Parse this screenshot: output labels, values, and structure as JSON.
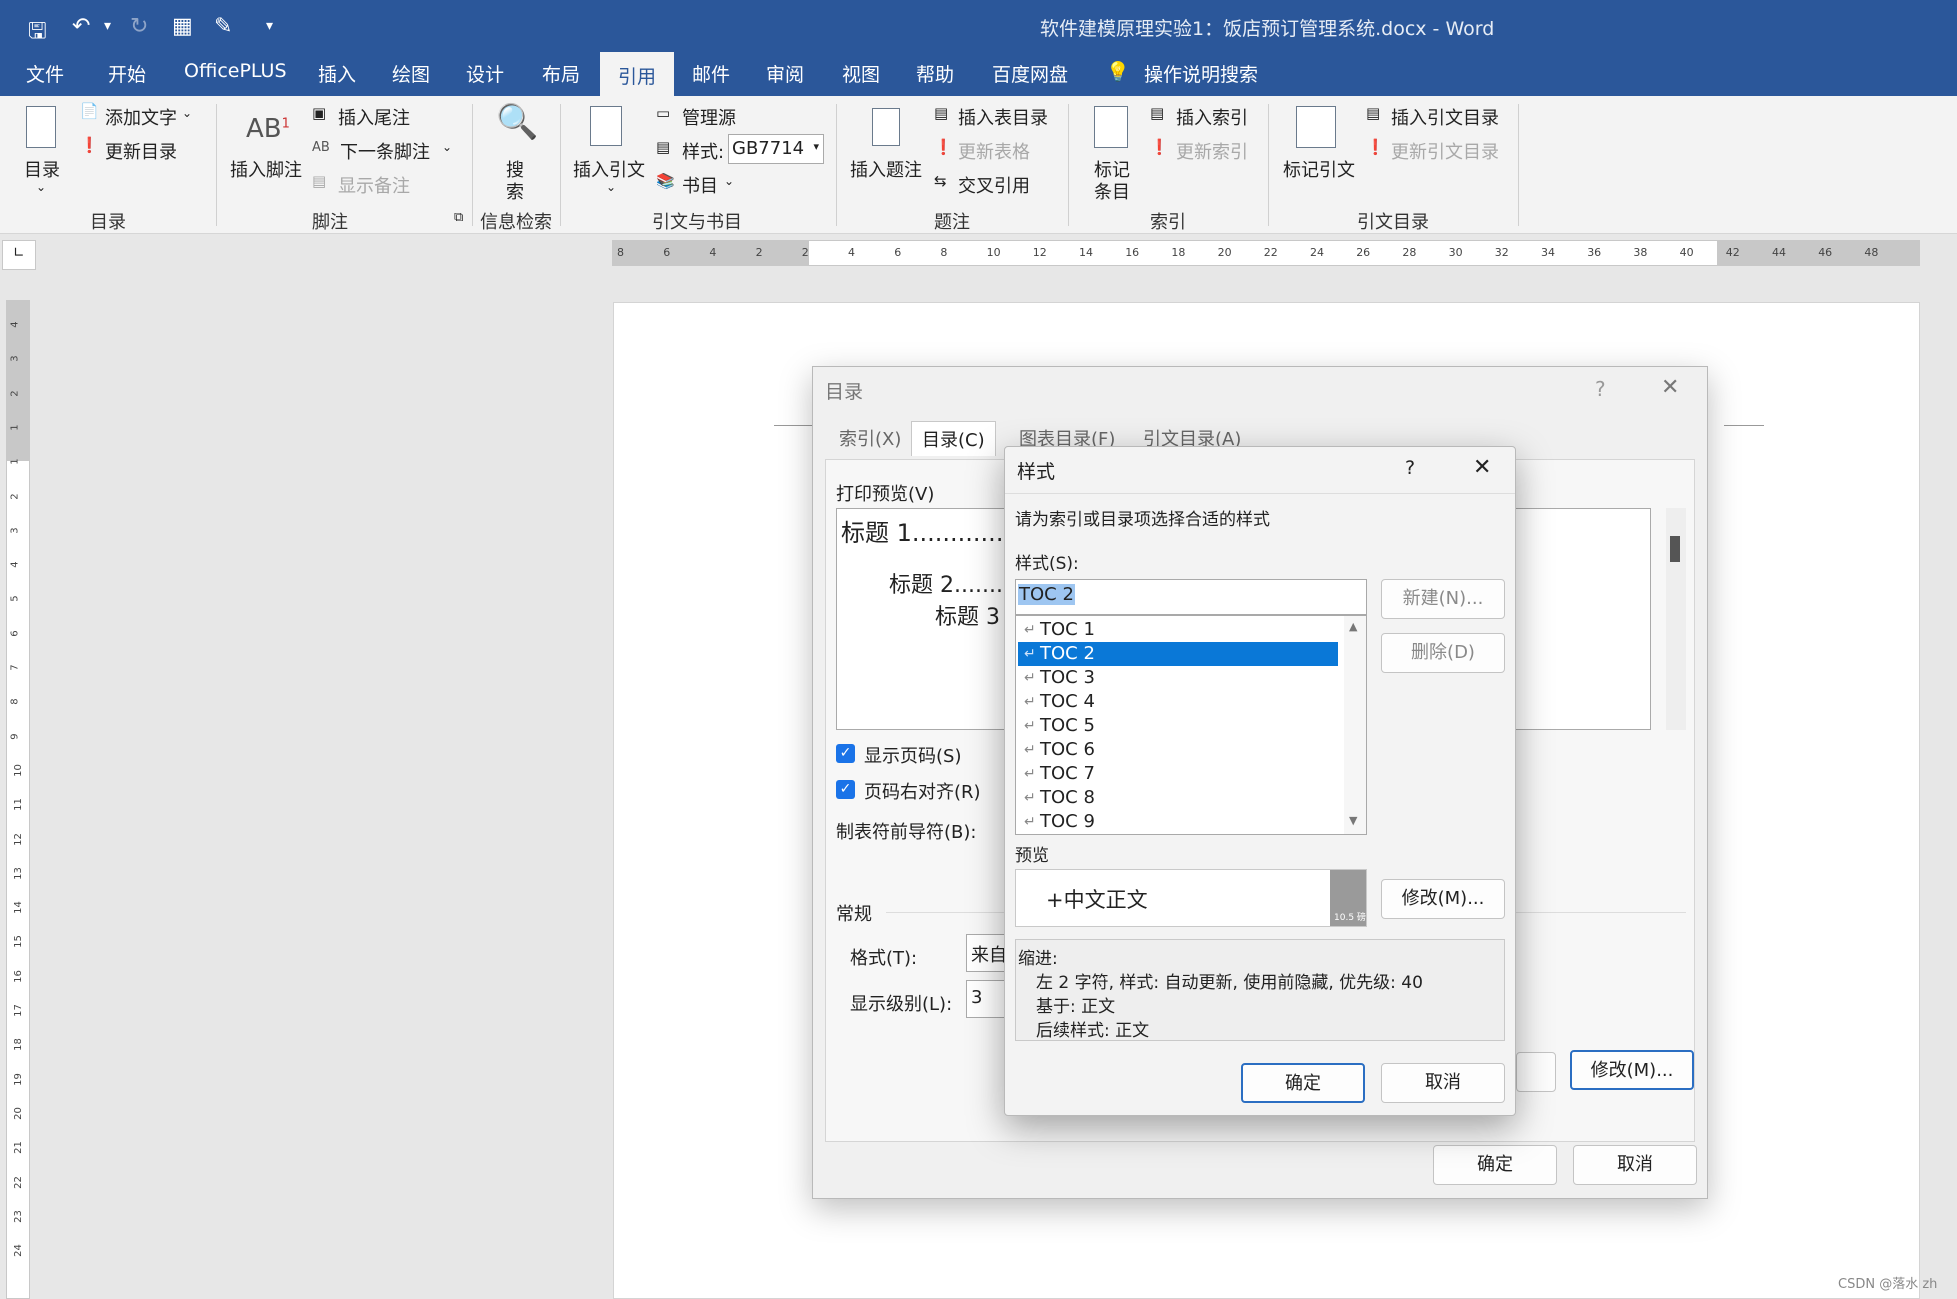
{
  "window": {
    "title": "软件建模原理实验1：饭店预订管理系统.docx  -  Word"
  },
  "menu": {
    "tabs": [
      "文件",
      "开始",
      "OfficePLUS",
      "插入",
      "绘图",
      "设计",
      "布局",
      "引用",
      "邮件",
      "审阅",
      "视图",
      "帮助",
      "百度网盘",
      "操作说明搜索"
    ],
    "active": "引用"
  },
  "ribbon": {
    "toc": {
      "big": "目录",
      "add_text": "添加文字",
      "update": "更新目录",
      "group": "目录"
    },
    "footnote": {
      "big": "插入脚注",
      "insert_endnote": "插入尾注",
      "next_footnote": "下一条脚注",
      "show_notes": "显示备注",
      "group": "脚注"
    },
    "search": {
      "big_top": "搜",
      "big_bottom": "索",
      "group": "信息检索"
    },
    "citations": {
      "big": "插入引文",
      "manage": "管理源",
      "style_label": "样式:",
      "style_value": "GB7714",
      "bibliography": "书目",
      "group": "引文与书目"
    },
    "captions": {
      "big": "插入题注",
      "insert_table_figures": "插入表目录",
      "update_table": "更新表格",
      "cross_ref": "交叉引用",
      "group": "题注"
    },
    "index": {
      "big_top": "标记",
      "big_bottom": "条目",
      "insert_index": "插入索引",
      "update_index": "更新索引",
      "group": "索引"
    },
    "toa": {
      "big": "标记引文",
      "insert_toa": "插入引文目录",
      "update_toa": "更新引文目录",
      "group": "引文目录"
    }
  },
  "toc_dialog": {
    "title": "目录",
    "help": "?",
    "close": "✕",
    "tabs": [
      "索引(X)",
      "目录(C)",
      "图表目录(F)",
      "引文目录(A)"
    ],
    "print_preview_label": "打印预览(V)",
    "preview_lines": [
      "标题 1.............",
      "标题 2........",
      "标题 3"
    ],
    "show_page_numbers": "显示页码(S)",
    "right_align": "页码右对齐(R)",
    "tab_leader_label": "制表符前导符(B):",
    "tab_leader_value": "...",
    "general_label": "常规",
    "format_label": "格式(T):",
    "format_value": "来自",
    "levels_label": "显示级别(L):",
    "levels_value": "3",
    "modify": "修改(M)...",
    "ok": "确定",
    "cancel": "取消"
  },
  "style_dialog": {
    "title": "样式",
    "help": "?",
    "close": "✕",
    "instruction": "请为索引或目录项选择合适的样式",
    "styles_label": "样式(S):",
    "style_input": "TOC 2",
    "styles": [
      "TOC 1",
      "TOC 2",
      "TOC 3",
      "TOC 4",
      "TOC 5",
      "TOC 6",
      "TOC 7",
      "TOC 8",
      "TOC 9"
    ],
    "selected": "TOC 2",
    "new": "新建(N)...",
    "delete": "删除(D)",
    "preview_label": "预览",
    "preview_text": "+中文正文",
    "preview_size": "10.5 磅",
    "modify": "修改(M)...",
    "desc": [
      "缩进:",
      "左  2 字符, 样式: 自动更新, 使用前隐藏, 优先级: 40",
      "基于: 正文",
      "后续样式: 正文"
    ],
    "ok": "确定",
    "cancel": "取消"
  },
  "ruler": {
    "h": [
      "8",
      "6",
      "4",
      "2",
      "2",
      "4",
      "6",
      "8",
      "10",
      "12",
      "14",
      "16",
      "18",
      "20",
      "22",
      "24",
      "26",
      "28",
      "30",
      "32",
      "34",
      "36",
      "38",
      "40",
      "42",
      "44",
      "46",
      "48"
    ],
    "v": [
      "4",
      "3",
      "2",
      "1",
      "1",
      "2",
      "3",
      "4",
      "5",
      "6",
      "7",
      "8",
      "9",
      "10",
      "11",
      "12",
      "13",
      "14",
      "15",
      "16",
      "17",
      "18",
      "19",
      "20",
      "21",
      "22",
      "23",
      "24"
    ]
  },
  "watermark": "CSDN @落水 zh",
  "colors": {
    "accent": "#2b579a",
    "selection": "#0a78d7",
    "checkbox": "#1a73e8"
  }
}
